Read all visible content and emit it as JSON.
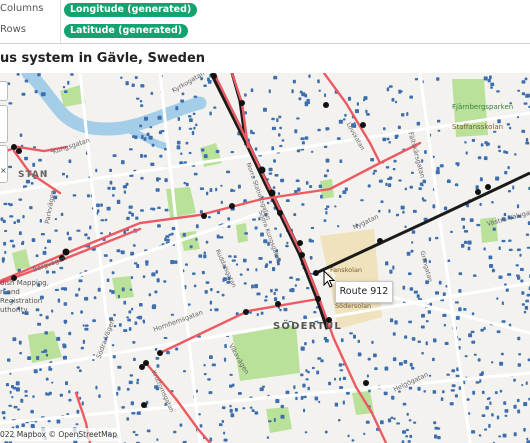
{
  "shelves": {
    "columns": {
      "label": "Columns",
      "pill": "Longitude (generated)"
    },
    "rows": {
      "label": "Rows",
      "pill": "Latitude (generated)"
    }
  },
  "worksheet": {
    "title": "us system in Gävle, Sweden"
  },
  "tooltip": {
    "text": "Route 912"
  },
  "attribution": {
    "text": "022 Mapbox © OpenStreetMap"
  },
  "map": {
    "district_labels": [
      "SÖDERTUL",
      "STAN"
    ],
    "park_labels": [
      "Fjärnbergsparken",
      "Staffansskolan",
      "Fanskolan",
      "Södersolan"
    ],
    "street_labels": [
      "Kungsgatan",
      "Parkvägen",
      "Bergvägen",
      "Norra Stationsgatan",
      "Södra Kungsgatan",
      "Ruddalsgatan",
      "Hornhemsgatan",
      "Södra Vägen",
      "Nygatan",
      "Helgögatan",
      "Kyrkogatan",
      "Vikavägen",
      "Fältskärsgatan",
      "Västra Valvgatan",
      "Kruttornsgatan",
      "Grangatan",
      "Lövskatan"
    ],
    "partial_labels": [
      "dish Mapping,",
      "n and",
      "Registration",
      "uthority"
    ],
    "colors": {
      "route_line": "#ec5a63",
      "route_dark": "#1a1a1a",
      "stop_dot": "#3d6fae",
      "water": "#a4cde8",
      "park": "#b9e19a",
      "land": "#f4f2ef",
      "campus": "#efe2bd",
      "pill": "#12a36e"
    }
  }
}
